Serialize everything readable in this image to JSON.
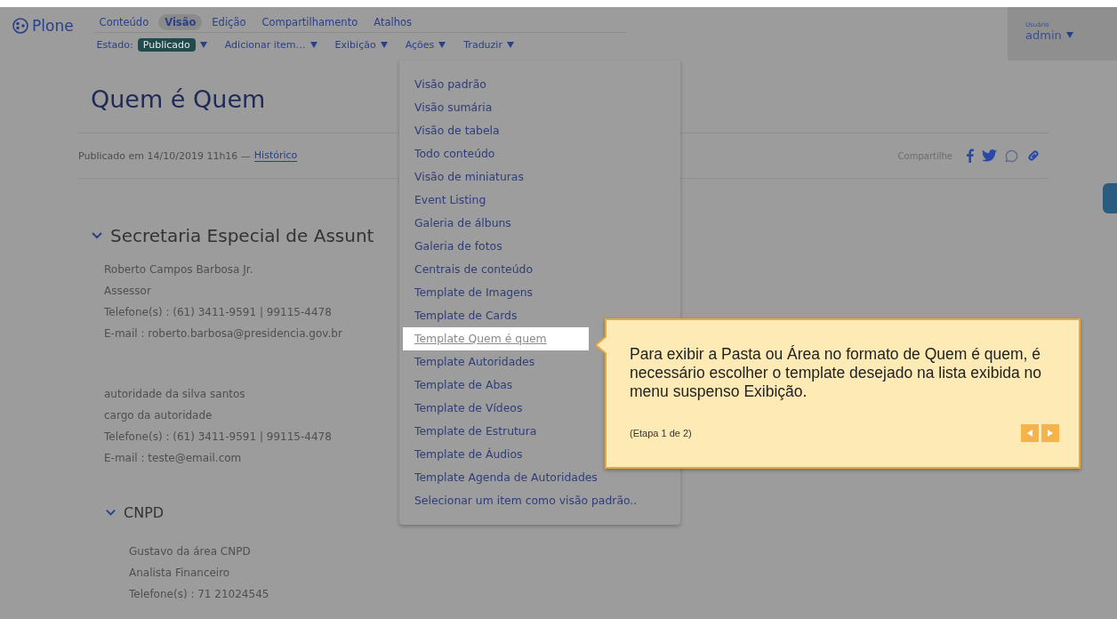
{
  "logo": {
    "text": "Plone"
  },
  "toolbar": {
    "tabs": [
      {
        "label": "Conteúdo",
        "selected": false
      },
      {
        "label": "Visão",
        "selected": true
      },
      {
        "label": "Edição",
        "selected": false
      },
      {
        "label": "Compartilhamento",
        "selected": false
      },
      {
        "label": "Atalhos",
        "selected": false
      }
    ],
    "actions": [
      {
        "kind": "status",
        "label": "Estado:",
        "value": "Publicado"
      },
      {
        "kind": "menu",
        "label": "Adicionar item…"
      },
      {
        "kind": "menu",
        "label": "Exibição"
      },
      {
        "kind": "menu",
        "label": "Ações"
      },
      {
        "kind": "menu",
        "label": "Traduzir"
      }
    ]
  },
  "user": {
    "caption": "Usuário",
    "name": "admin"
  },
  "page": {
    "title": "Quem é Quem",
    "byline": "Publicado em 14/10/2019 11h16 —",
    "history_link": "Histórico",
    "share_label": "Compartilhe",
    "sections": [
      {
        "title": "Secretaria Especial de Assunt",
        "expanded": true,
        "entries": [
          {
            "lines": [
              "Roberto Campos Barbosa Jr.",
              "Assessor",
              "Telefone(s) :  (61) 3411-9591 | 99115-4478",
              "E-mail :  roberto.barbosa@presidencia.gov.br"
            ]
          },
          {
            "lines": [
              "autoridade da silva santos",
              "cargo da autoridade",
              "Telefone(s) :  (61) 3411-9591 | 99115-4478",
              "E-mail :  teste@email.com"
            ]
          }
        ],
        "children": [
          {
            "title": "CNPD",
            "expanded": true,
            "entries": [
              {
                "lines": [
                  "Gustavo da área CNPD",
                  "Analista Financeiro",
                  "Telefone(s) :  71 21024545"
                ]
              }
            ]
          }
        ]
      }
    ]
  },
  "menu": {
    "items": [
      {
        "label": "Visão padrão",
        "selected": false
      },
      {
        "label": "Visão sumária",
        "selected": false
      },
      {
        "label": "Visão de tabela",
        "selected": false
      },
      {
        "label": "Todo conteúdo",
        "selected": false
      },
      {
        "label": "Visão de miniaturas",
        "selected": false
      },
      {
        "label": "Event Listing",
        "selected": false
      },
      {
        "label": "Galeria de álbuns",
        "selected": false
      },
      {
        "label": "Galeria de fotos",
        "selected": false
      },
      {
        "label": "Centrais de conteúdo",
        "selected": false
      },
      {
        "label": "Template de Imagens",
        "selected": false
      },
      {
        "label": "Template de Cards",
        "selected": false
      },
      {
        "label": "Template Quem é quem",
        "selected": true
      },
      {
        "label": "Template Autoridades",
        "selected": false
      },
      {
        "label": "Template de Abas",
        "selected": false
      },
      {
        "label": "Template de Vídeos",
        "selected": false
      },
      {
        "label": "Template de Estrutura",
        "selected": false
      },
      {
        "label": "Template de Áudios",
        "selected": false
      },
      {
        "label": "Template Agenda de Autoridades",
        "selected": false
      },
      {
        "label": "Selecionar um item como visão padrão..",
        "selected": false
      }
    ]
  },
  "tour": {
    "text": "Para exibir a Pasta ou Área no formato de Quem é quem, é necessário escolher o template desejado na lista exibida no menu suspenso Exibição.",
    "step": "(Etapa 1 de 2)"
  }
}
